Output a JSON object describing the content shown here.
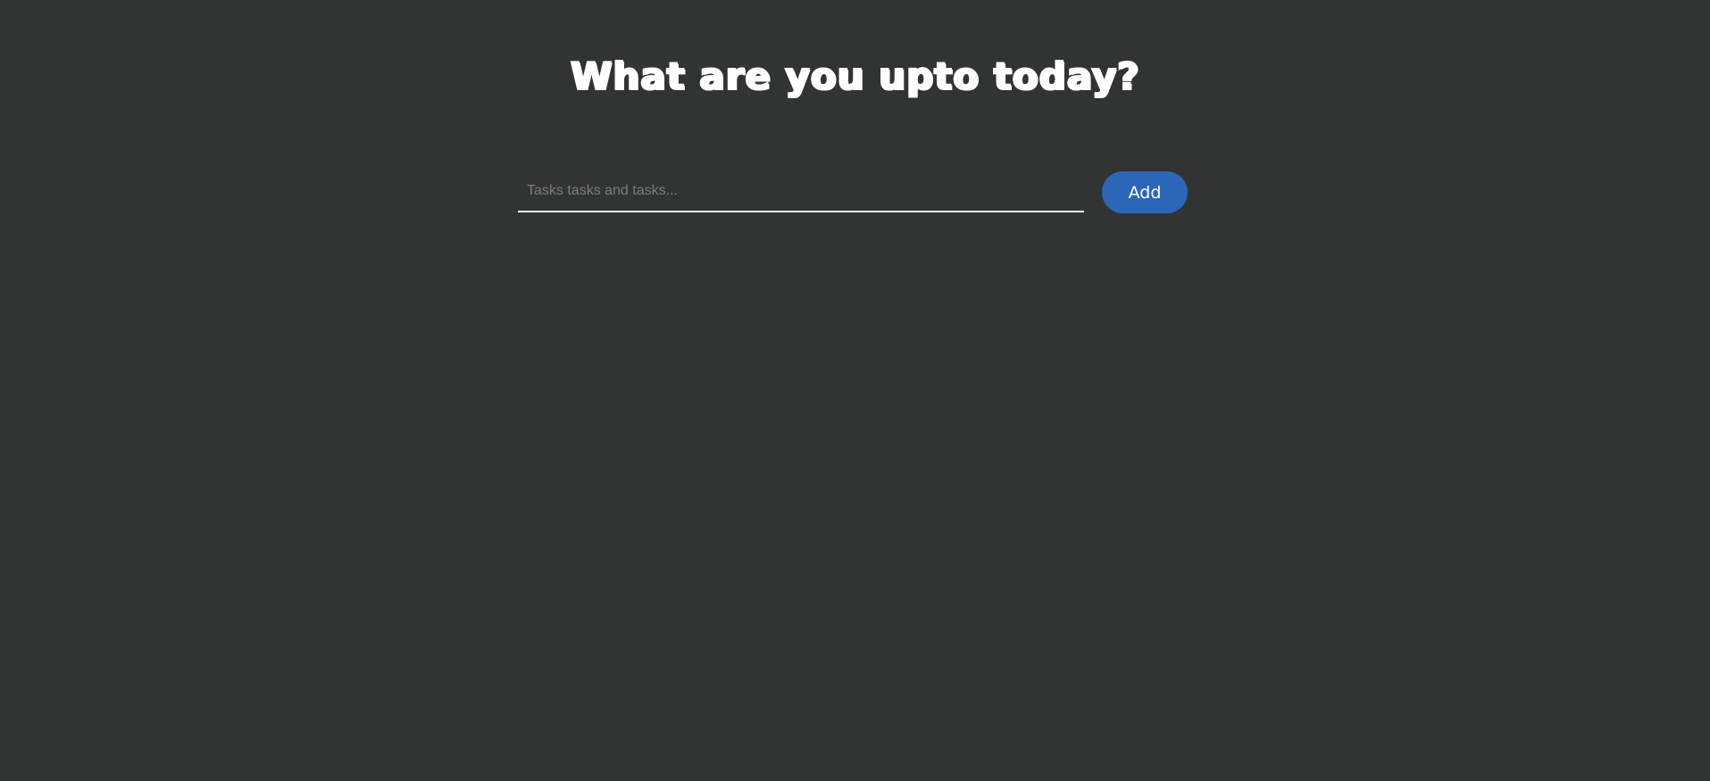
{
  "header": {
    "title": "What are you upto today?"
  },
  "task_form": {
    "input_value": "",
    "input_placeholder": "Tasks tasks and tasks...",
    "add_label": "Add"
  },
  "colors": {
    "background": "#323333",
    "accent": "#2c66b8",
    "text": "#ffffff"
  }
}
